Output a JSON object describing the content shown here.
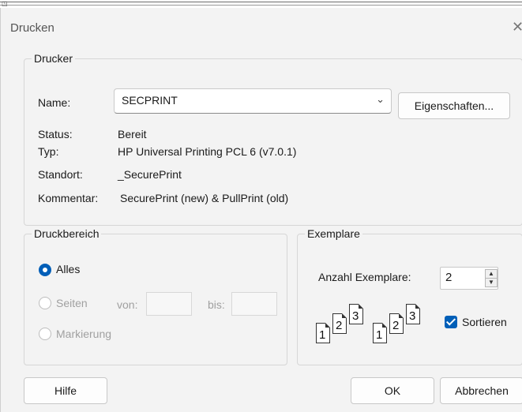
{
  "window": {
    "title": "Drucken",
    "close_glyph": "✕",
    "top_glyph": "◳"
  },
  "printer_group": {
    "title": "Drucker",
    "name_label": "Name:",
    "name_value": "SECPRINT",
    "properties_button": "Eigenschaften...",
    "status_label": "Status:",
    "status_value": "Bereit",
    "type_label": "Typ:",
    "type_value": "HP Universal Printing PCL 6 (v7.0.1)",
    "location_label": "Standort:",
    "location_value": "_SecurePrint",
    "comment_label": "Kommentar:",
    "comment_value": "SecurePrint (new) & PullPrint (old)"
  },
  "range_group": {
    "title": "Druckbereich",
    "all_label": "Alles",
    "pages_label": "Seiten",
    "from_label": "von:",
    "to_label": "bis:",
    "selection_label": "Markierung",
    "selected": "Alles"
  },
  "copies_group": {
    "title": "Exemplare",
    "count_label": "Anzahl Exemplare:",
    "count_value": "2",
    "collate_label": "Sortieren",
    "collate_checked": true,
    "pages_1": [
      "1",
      "2",
      "3"
    ],
    "pages_2": [
      "1",
      "2",
      "3"
    ]
  },
  "buttons": {
    "help": "Hilfe",
    "ok": "OK",
    "cancel": "Abbrechen"
  }
}
